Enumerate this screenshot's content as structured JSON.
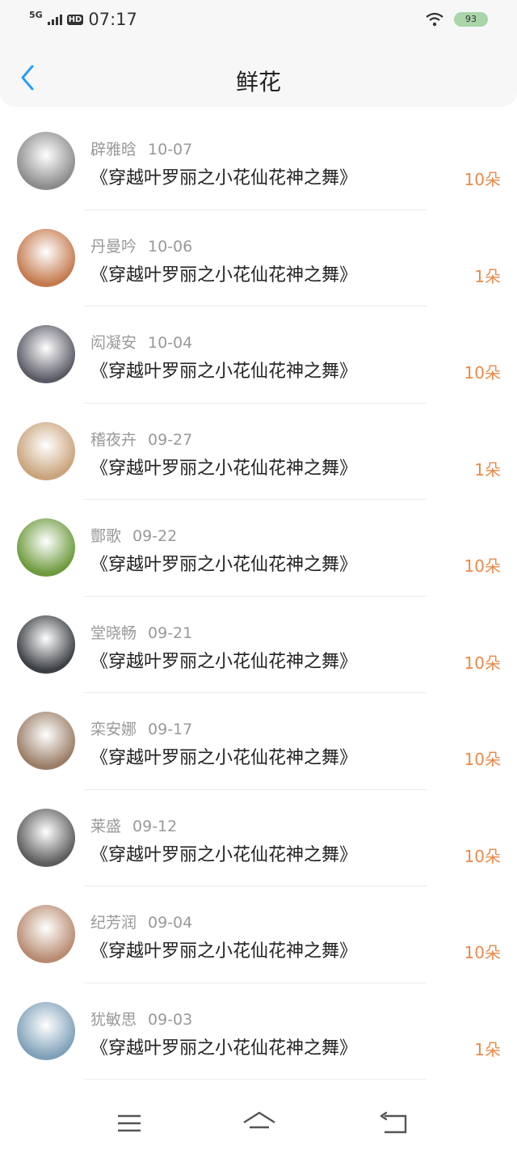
{
  "status_bar": {
    "network": "5G",
    "hd": "HD",
    "time": "07:17",
    "battery": "93",
    "icons": [
      "signal-icon",
      "wifi-icon",
      "battery-icon"
    ]
  },
  "header": {
    "title": "鲜花",
    "back_icon": "chevron-left-icon"
  },
  "colors": {
    "accent": "#2a9df4",
    "count": "#e98a4a",
    "meta": "#999999"
  },
  "list": [
    {
      "name": "辟雅晗",
      "date": "10-07",
      "title": "《穿越叶罗丽之小花仙花神之舞》",
      "count": "10朵",
      "avatar_color": "#8c8c8c"
    },
    {
      "name": "丹曼吟",
      "date": "10-06",
      "title": "《穿越叶罗丽之小花仙花神之舞》",
      "count": "1朵",
      "avatar_color": "#c47a4e"
    },
    {
      "name": "闳凝安",
      "date": "10-04",
      "title": "《穿越叶罗丽之小花仙花神之舞》",
      "count": "10朵",
      "avatar_color": "#5a5a66"
    },
    {
      "name": "稽夜卉",
      "date": "09-27",
      "title": "《穿越叶罗丽之小花仙花神之舞》",
      "count": "1朵",
      "avatar_color": "#c9a37a"
    },
    {
      "name": "酆歌",
      "date": "09-22",
      "title": "《穿越叶罗丽之小花仙花神之舞》",
      "count": "10朵",
      "avatar_color": "#6d9a3c"
    },
    {
      "name": "堂晓畅",
      "date": "09-21",
      "title": "《穿越叶罗丽之小花仙花神之舞》",
      "count": "10朵",
      "avatar_color": "#3b3f44"
    },
    {
      "name": "栾安娜",
      "date": "09-17",
      "title": "《穿越叶罗丽之小花仙花神之舞》",
      "count": "10朵",
      "avatar_color": "#9a7d66"
    },
    {
      "name": "莱盛",
      "date": "09-12",
      "title": "《穿越叶罗丽之小花仙花神之舞》",
      "count": "10朵",
      "avatar_color": "#5c5c5c"
    },
    {
      "name": "纪芳润",
      "date": "09-04",
      "title": "《穿越叶罗丽之小花仙花神之舞》",
      "count": "10朵",
      "avatar_color": "#b88a6f"
    },
    {
      "name": "犹敏思",
      "date": "09-03",
      "title": "《穿越叶罗丽之小花仙花神之舞》",
      "count": "1朵",
      "avatar_color": "#7ea0b8"
    }
  ],
  "nav_bar": {
    "icons": [
      "menu-icon",
      "home-icon",
      "back-icon"
    ]
  }
}
